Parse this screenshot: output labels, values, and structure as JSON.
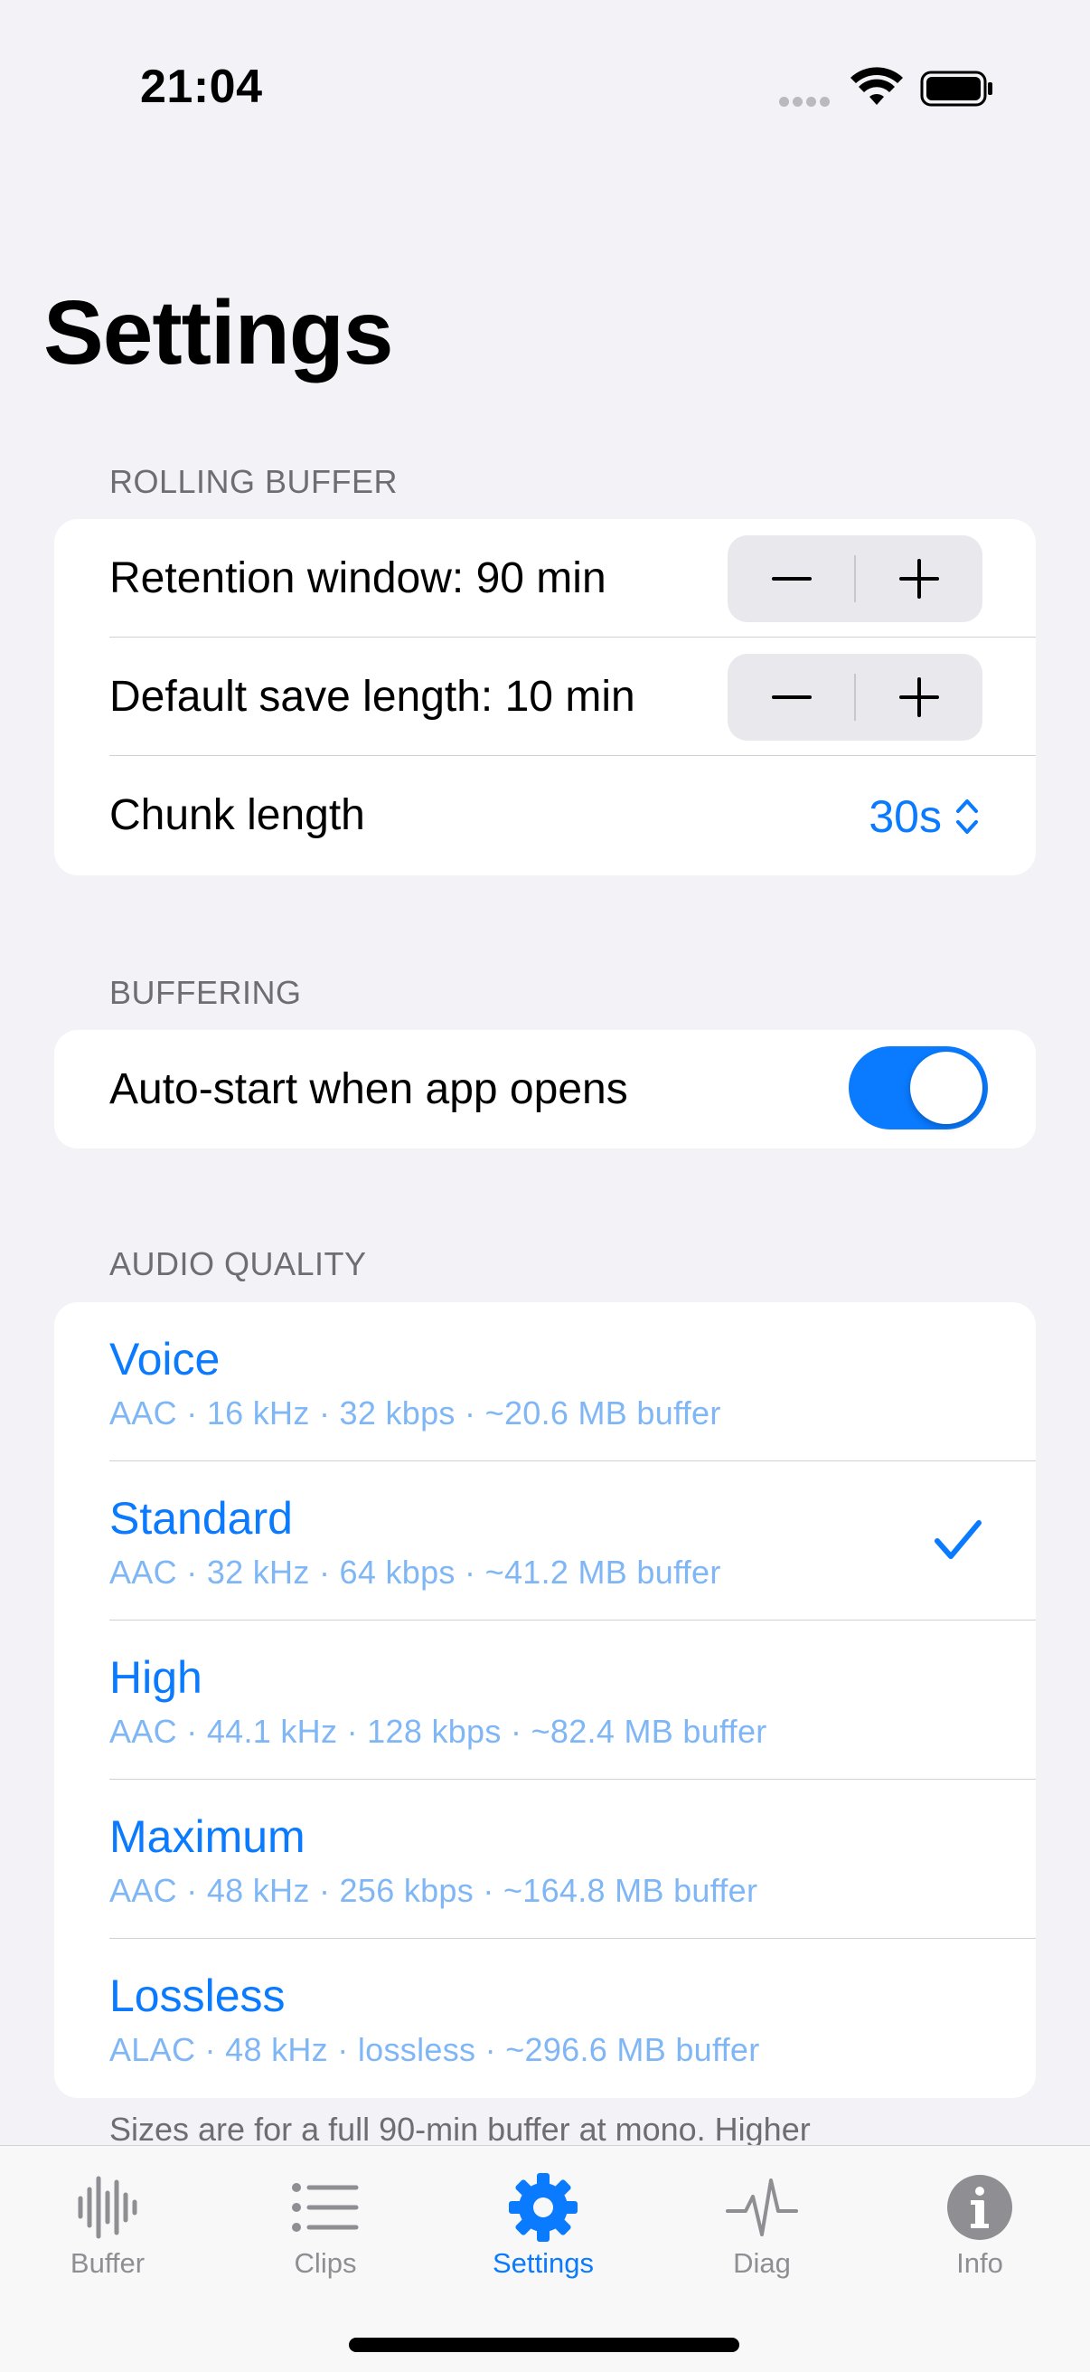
{
  "status_bar": {
    "time": "21:04"
  },
  "page": {
    "title": "Settings"
  },
  "rolling_buffer": {
    "header": "ROLLING BUFFER",
    "retention_label": "Retention window: 90 min",
    "default_save_label": "Default save length: 10 min",
    "chunk_label": "Chunk length",
    "chunk_value": "30s"
  },
  "buffering": {
    "header": "BUFFERING",
    "auto_start_label": "Auto-start when app opens",
    "auto_start_on": true
  },
  "audio_quality": {
    "header": "AUDIO QUALITY",
    "options": [
      {
        "name": "Voice",
        "detail": "AAC · 16 kHz · 32 kbps · ~20.6 MB buffer",
        "selected": false
      },
      {
        "name": "Standard",
        "detail": "AAC · 32 kHz · 64 kbps · ~41.2 MB buffer",
        "selected": true
      },
      {
        "name": "High",
        "detail": "AAC · 44.1 kHz · 128 kbps · ~82.4 MB buffer",
        "selected": false
      },
      {
        "name": "Maximum",
        "detail": "AAC · 48 kHz · 256 kbps · ~164.8 MB buffer",
        "selected": false
      },
      {
        "name": "Lossless",
        "detail": "ALAC · 48 kHz · lossless · ~296.6 MB buffer",
        "selected": false
      }
    ],
    "footnote": "Sizes are for a full 90-min buffer at mono. Higher"
  },
  "tab_bar": {
    "tabs": [
      {
        "label": "Buffer",
        "icon": "waveform-icon",
        "active": false
      },
      {
        "label": "Clips",
        "icon": "list-icon",
        "active": false
      },
      {
        "label": "Settings",
        "icon": "gear-icon",
        "active": true
      },
      {
        "label": "Diag",
        "icon": "pulse-icon",
        "active": false
      },
      {
        "label": "Info",
        "icon": "info-icon",
        "active": false
      }
    ]
  },
  "colors": {
    "accent": "#0a7aff",
    "background": "#f2f2f7",
    "card": "#ffffff",
    "secondary_text": "#6d6d72"
  }
}
